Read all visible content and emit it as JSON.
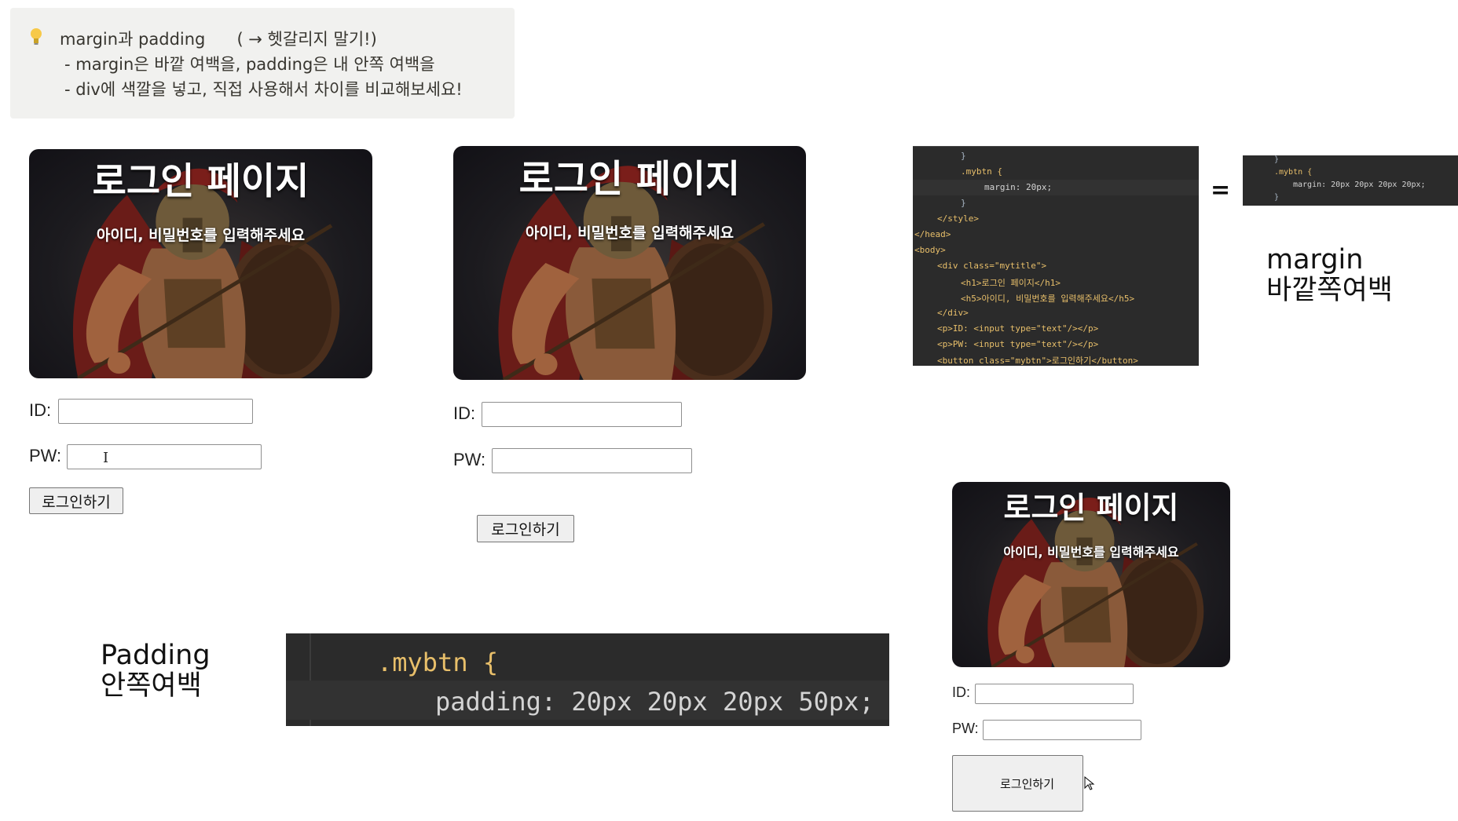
{
  "callout": {
    "line1": "margin과 padding      ( → 헷갈리지 말기!)",
    "line2": "- margin은 바깥 여백을, padding은 내 안쪽 여백을",
    "line3": "- div에 색깔을 넣고, 직접 사용해서 차이를 비교해보세요!"
  },
  "login": {
    "title": "로그인 페이지",
    "subtitle": "아이디, 비밀번호를 입력해주세요",
    "id_label": "ID:",
    "pw_label": "PW:",
    "button": "로그인하기"
  },
  "code_margin": {
    "lines": [
      "}",
      ".mybtn {",
      "margin: 20px;",
      "}",
      "</style>",
      "</head>",
      "<body>",
      "<div class=\"mytitle\">",
      "<h1>로그인 페이지</h1>",
      "<h5>아이디, 비밀번호를 입력해주세요</h5>",
      "</div>",
      "<p>ID: <input type=\"text\"/></p>",
      "<p>PW: <input type=\"text\"/></p>",
      "<button class=\"mybtn\">로그인하기</button>"
    ]
  },
  "equals": "=",
  "code_margin_full": {
    "line1": "}",
    "line2": ".mybtn {",
    "line3": "margin: 20px 20px 20px 20px;",
    "line4": "}"
  },
  "margin_label": {
    "line1": "margin",
    "line2": "바깥쪽여백"
  },
  "padding_label": {
    "line1": "Padding",
    "line2": "안쪽여백"
  },
  "code_padding": {
    "line1": ".mybtn {",
    "line2": "padding: 20px 20px 20px 50px;"
  },
  "colors": {
    "callout_bg": "#f1f1ef",
    "code_bg": "#2b2b2b",
    "button_bg": "#efefef"
  }
}
